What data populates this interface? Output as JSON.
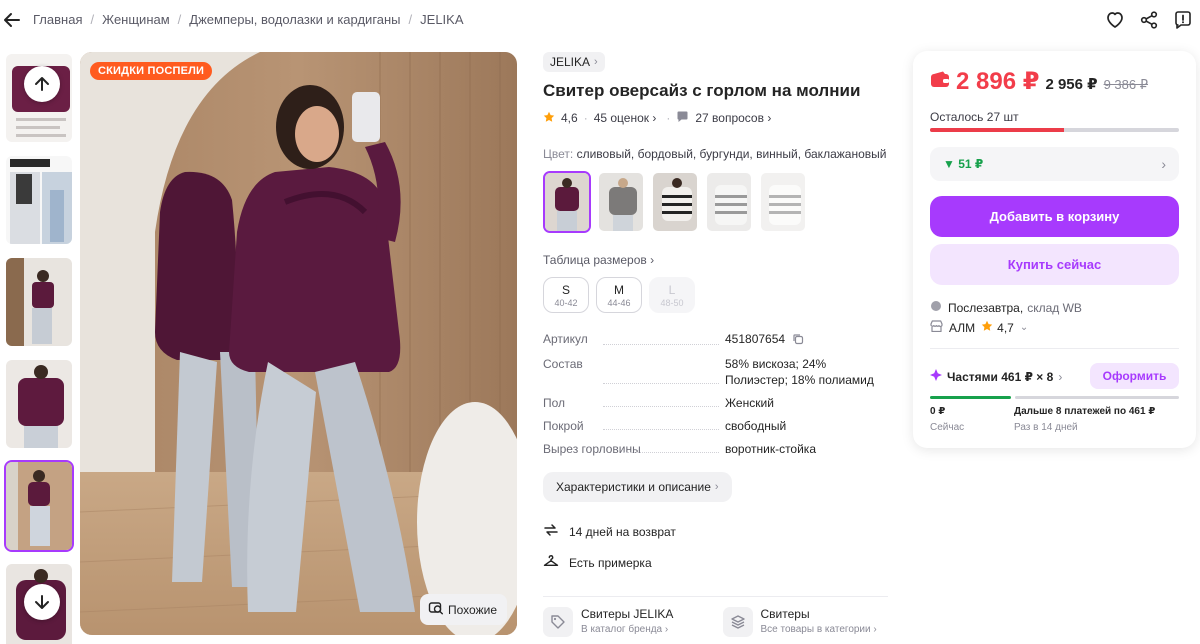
{
  "breadcrumb": [
    "Главная",
    "Женщинам",
    "Джемперы, водолазки и кардиганы",
    "JELIKA"
  ],
  "icons": {
    "back": "arrow-left-icon",
    "favorite": "heart-icon",
    "share": "share-icon",
    "report": "report-icon"
  },
  "gallery": {
    "badge": "СКИДКИ ПОСПЕЛИ",
    "similar_label": "Похожие",
    "active_thumb": 5
  },
  "product": {
    "brand": "JELIKA",
    "title": "Свитер оверсайз с горлом на молнии",
    "rating": "4,6",
    "reviews": "45 оценок",
    "questions": "27 вопросов",
    "color_label": "Цвет:",
    "colors": "сливовый, бордовый, бургунди, винный, баклажановый",
    "size_table": "Таблица размеров",
    "sizes": [
      {
        "size": "S",
        "range": "40-42",
        "available": true
      },
      {
        "size": "M",
        "range": "44-46",
        "available": true
      },
      {
        "size": "L",
        "range": "48-50",
        "available": false
      }
    ],
    "specs": [
      {
        "key": "Артикул",
        "value": "451807654"
      },
      {
        "key": "Состав",
        "value": "58% вискоза; 24% Полиэстер; 18% полиамид"
      },
      {
        "key": "Пол",
        "value": "Женский"
      },
      {
        "key": "Покрой",
        "value": "свободный"
      },
      {
        "key": "Вырез горловины",
        "value": "воротник-стойка"
      }
    ],
    "desc_button": "Характеристики и описание",
    "benefits": [
      {
        "icon": "return-icon",
        "text": "14 дней на возврат"
      },
      {
        "icon": "hanger-icon",
        "text": "Есть примерка"
      }
    ],
    "categories": [
      {
        "icon": "tag-icon",
        "title": "Свитеры JELIKA",
        "subtitle": "В каталог бренда"
      },
      {
        "icon": "layers-icon",
        "title": "Свитеры",
        "subtitle": "Все товары в категории"
      }
    ]
  },
  "buybox": {
    "price": "2 896 ₽",
    "price_wallet": "2 956 ₽",
    "price_old": "9 386 ₽",
    "stock_label": "Осталось 27 шт",
    "stock_fraction": 0.54,
    "bonus": "▼ 51 ₽",
    "add_to_cart": "Добавить в корзину",
    "buy_now": "Купить сейчас",
    "delivery": "Послезавтра,",
    "warehouse": "склад WB",
    "seller": "АЛМ",
    "seller_rating": "4,7",
    "split_label": "Частями 461 ₽ × 8",
    "split_button": "Оформить",
    "split_now_amount": "0 ₽",
    "split_now_label": "Сейчас",
    "split_later_amount": "Дальше 8 платежей по 461 ₽",
    "split_later_label": "Раз в 14 дней"
  },
  "colors": {
    "accent": "#a73afd",
    "price": "#f23d4a",
    "bonus": "#17a14c",
    "badge": "#ff5b1f"
  }
}
